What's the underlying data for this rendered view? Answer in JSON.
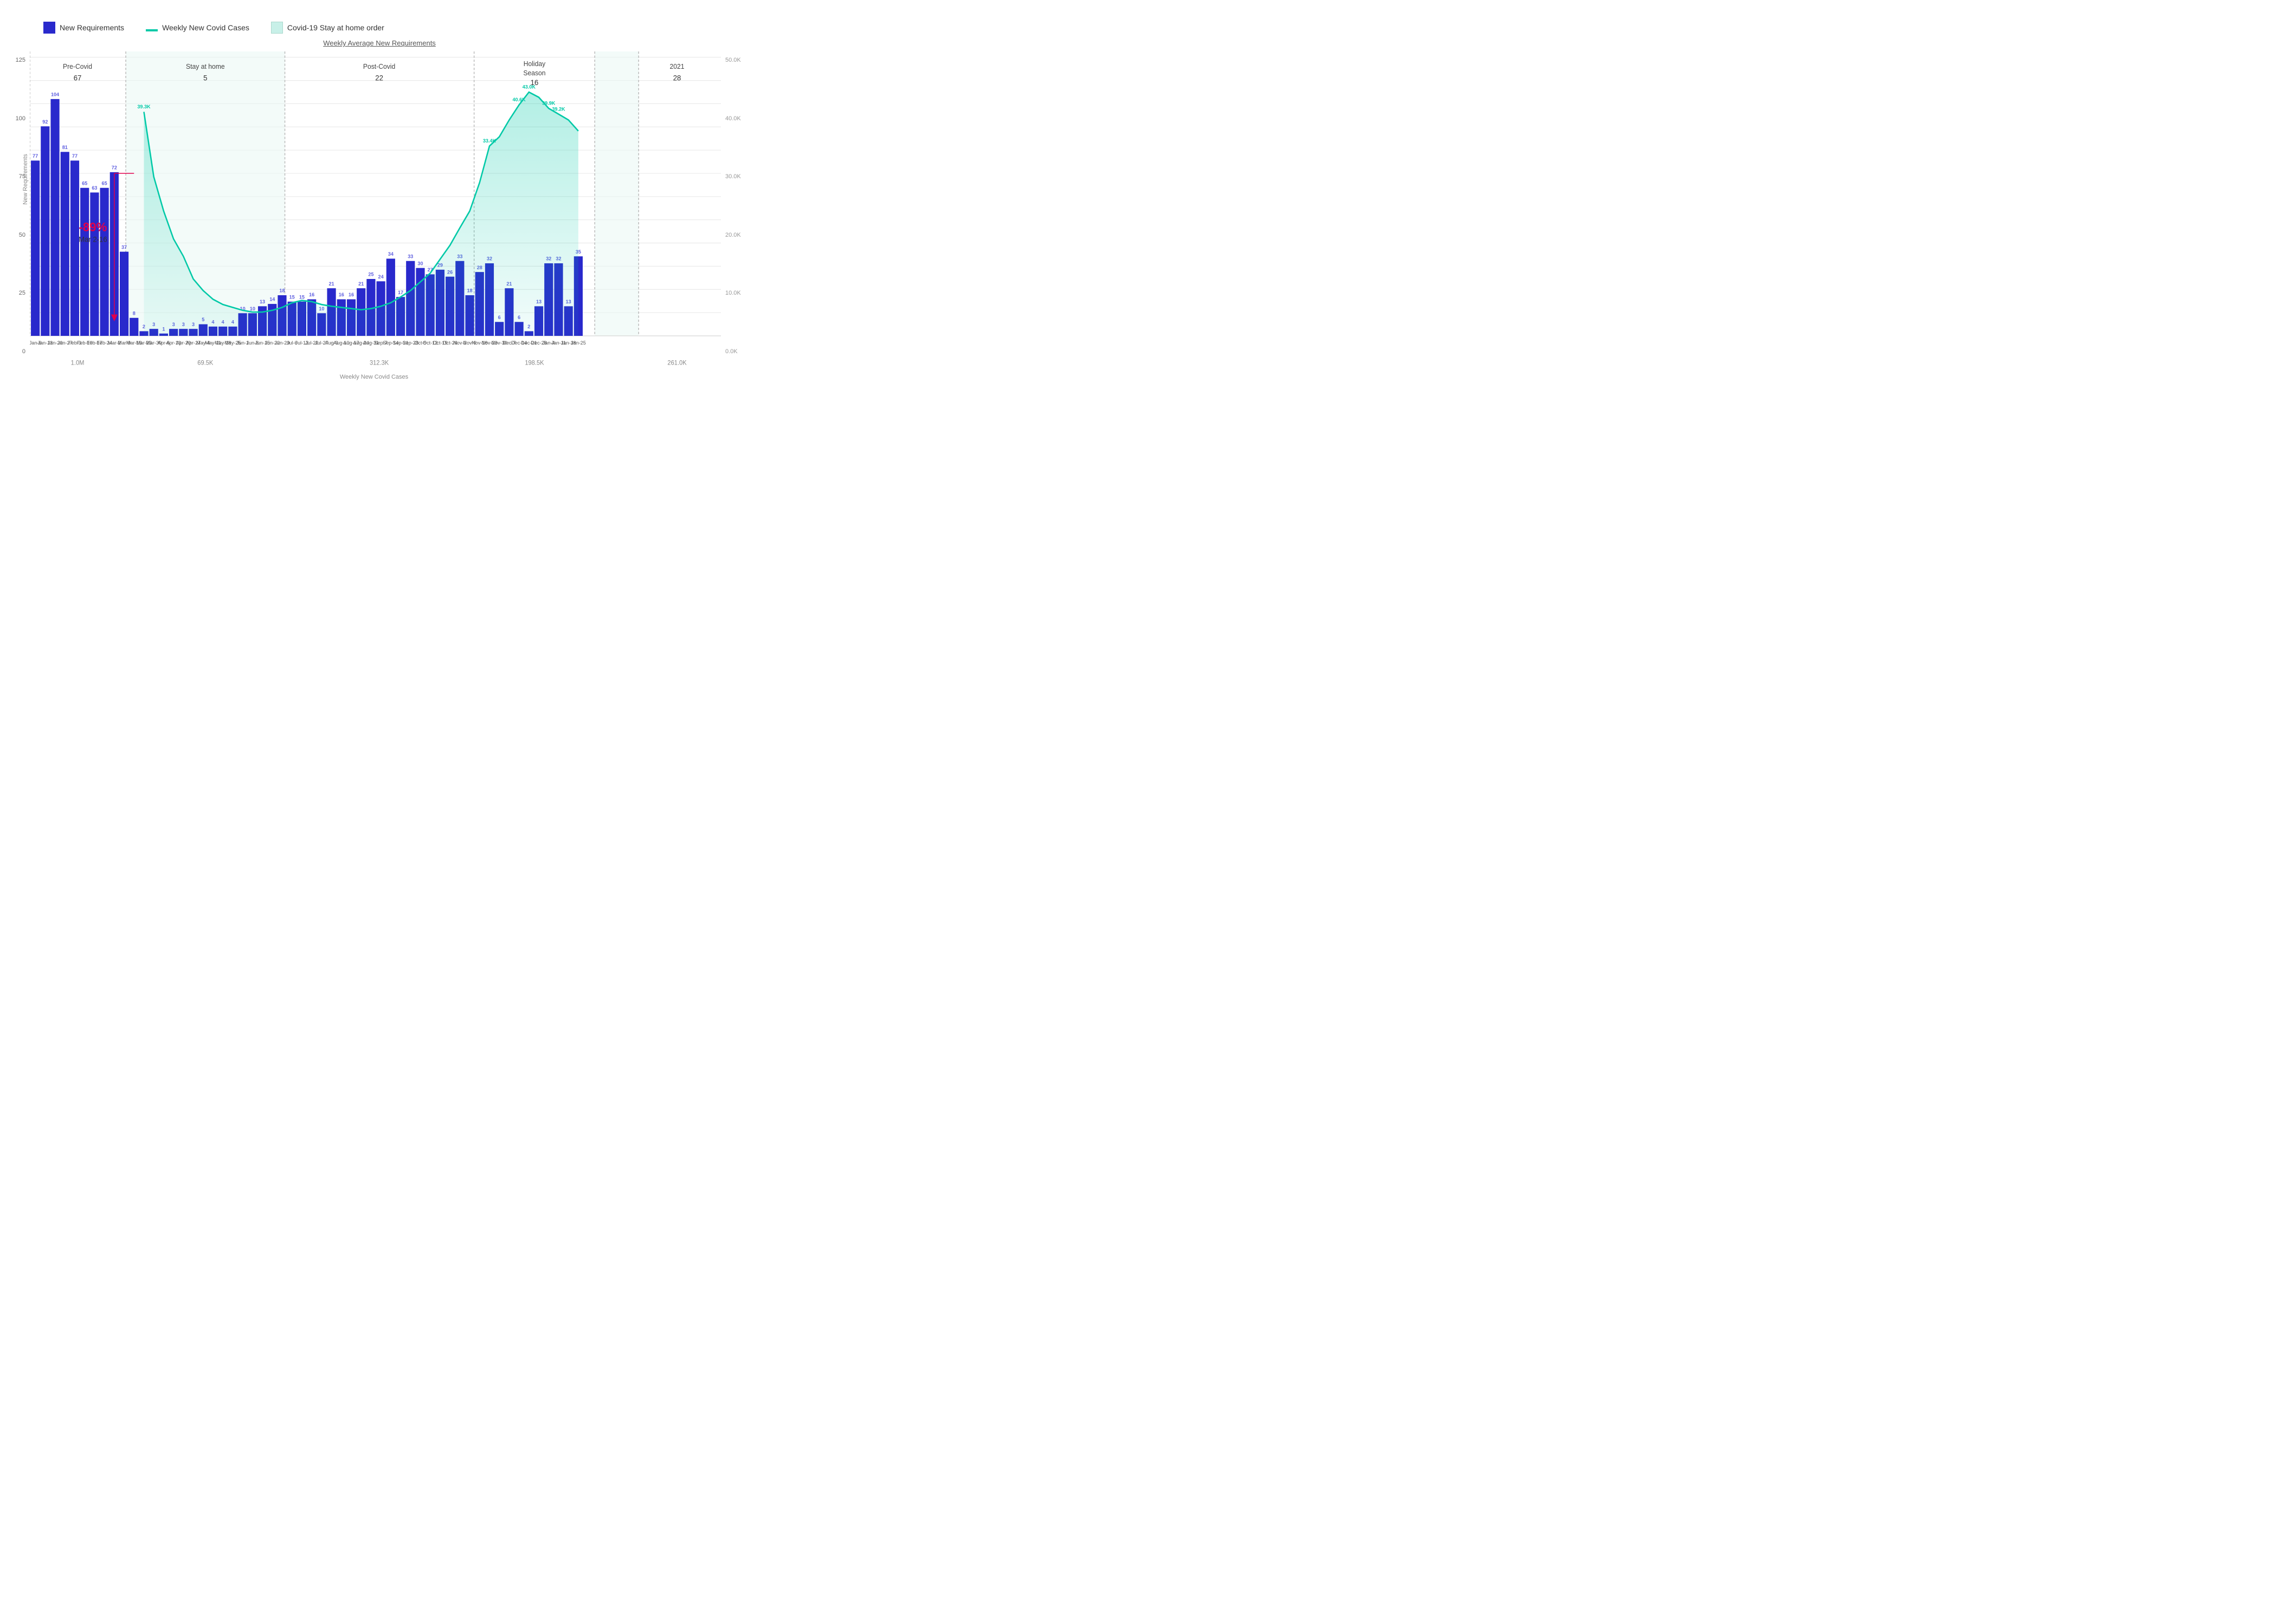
{
  "title": "Weekly Average New Requirements",
  "legend": {
    "items": [
      {
        "label": "New Requirements",
        "color": "#2929cc",
        "type": "box"
      },
      {
        "label": "Weekly New Covid Cases",
        "color": "#00c9a7",
        "type": "line"
      },
      {
        "label": "Covid-19 Stay at home order",
        "color": "#c8f0e8",
        "type": "box"
      }
    ]
  },
  "yAxisLeft": {
    "label": "New Requirements",
    "ticks": [
      "125",
      "100",
      "75",
      "50",
      "25",
      "0"
    ]
  },
  "yAxisRight": {
    "label": "Weekly New Covid Cases",
    "ticks": [
      "50.0K",
      "40.0K",
      "30.0K",
      "20.0K",
      "10.0K",
      "0.0K"
    ]
  },
  "sections": [
    {
      "label": "Pre-Covid",
      "avg": "67"
    },
    {
      "label": "Stay at home",
      "avg": "5"
    },
    {
      "label": "Post-Covid",
      "avg": "22"
    },
    {
      "label": "Holiday\nSeason",
      "avg": "16"
    },
    {
      "label": "2021",
      "avg": "28"
    }
  ],
  "bottomLabels": [
    "1.0M",
    "69.5K",
    "312.3K",
    "198.5K",
    "261.0K"
  ],
  "annotation": {
    "pct": "-89%",
    "date": "Mar 2-16"
  },
  "bars": [
    {
      "x": "Jan-6",
      "v": 77,
      "covidV": null
    },
    {
      "x": "Jan-13",
      "v": 92,
      "covidV": null
    },
    {
      "x": "Jan-20",
      "v": 104,
      "covidV": null
    },
    {
      "x": "Jan-27",
      "v": 81,
      "covidV": null
    },
    {
      "x": "Feb-3",
      "v": 77,
      "covidV": null
    },
    {
      "x": "Feb-10",
      "v": 65,
      "covidV": null
    },
    {
      "x": "Feb-17",
      "v": 63,
      "covidV": null
    },
    {
      "x": "Feb-24",
      "v": 65,
      "covidV": null
    },
    {
      "x": "Mar-2",
      "v": 72,
      "covidV": null
    },
    {
      "x": "Mar-9",
      "v": 37,
      "covidV": null
    },
    {
      "x": "Mar-16",
      "v": 8,
      "covidV": null
    },
    {
      "x": "Mar-23",
      "v": 2,
      "covidV": 39300
    },
    {
      "x": "Mar-30",
      "v": 3,
      "covidV": 28000
    },
    {
      "x": "Apr-6",
      "v": 1,
      "covidV": 22000
    },
    {
      "x": "Apr-13",
      "v": 3,
      "covidV": 17000
    },
    {
      "x": "Apr-20",
      "v": 3,
      "covidV": 13000
    },
    {
      "x": "Apr-27",
      "v": 3,
      "covidV": 10000
    },
    {
      "x": "May-4",
      "v": 5,
      "covidV": 8000
    },
    {
      "x": "May-11",
      "v": 4,
      "covidV": 6500
    },
    {
      "x": "May-18",
      "v": 4,
      "covidV": 5500
    },
    {
      "x": "May-25",
      "v": 4,
      "covidV": 5000
    },
    {
      "x": "Jun-1",
      "v": 10,
      "covidV": 4500
    },
    {
      "x": "Jun-8",
      "v": 10,
      "covidV": 4200
    },
    {
      "x": "Jun-15",
      "v": 13,
      "covidV": 4200
    },
    {
      "x": "Jun-22",
      "v": 14,
      "covidV": 4500
    },
    {
      "x": "Jun-29",
      "v": 18,
      "covidV": 5000
    },
    {
      "x": "Jul-6",
      "v": 15,
      "covidV": 5800
    },
    {
      "x": "Jul-13",
      "v": 15,
      "covidV": 6200
    },
    {
      "x": "Jul-20",
      "v": 16,
      "covidV": 6000
    },
    {
      "x": "Jul-27",
      "v": 10,
      "covidV": 5500
    },
    {
      "x": "Aug-3",
      "v": 21,
      "covidV": 5200
    },
    {
      "x": "Aug-10",
      "v": 16,
      "covidV": 5000
    },
    {
      "x": "Aug-17",
      "v": 16,
      "covidV": 4800
    },
    {
      "x": "Aug-24",
      "v": 21,
      "covidV": 4600
    },
    {
      "x": "Aug-31",
      "v": 25,
      "covidV": 4800
    },
    {
      "x": "Sep-7",
      "v": 24,
      "covidV": 5200
    },
    {
      "x": "Sep-14",
      "v": 34,
      "covidV": 5800
    },
    {
      "x": "Sep-21",
      "v": 17,
      "covidV": 6800
    },
    {
      "x": "Sep-28",
      "v": 33,
      "covidV": 8000
    },
    {
      "x": "Oct-5",
      "v": 30,
      "covidV": 9500
    },
    {
      "x": "Oct-12",
      "v": 27,
      "covidV": 11000
    },
    {
      "x": "Oct-19",
      "v": 29,
      "covidV": 13500
    },
    {
      "x": "Oct-26",
      "v": 26,
      "covidV": 16000
    },
    {
      "x": "Nov-2",
      "v": 33,
      "covidV": 19000
    },
    {
      "x": "Nov-9",
      "v": 18,
      "covidV": 22000
    },
    {
      "x": "Nov-16",
      "v": 28,
      "covidV": 27000
    },
    {
      "x": "Nov-23",
      "v": 32,
      "covidV": 33400
    },
    {
      "x": "Nov-30",
      "v": 6,
      "covidV": 35000
    },
    {
      "x": "Dec-7",
      "v": 21,
      "covidV": 38000
    },
    {
      "x": "Dec-14",
      "v": 6,
      "covidV": 40600
    },
    {
      "x": "Dec-21",
      "v": 2,
      "covidV": 43000
    },
    {
      "x": "Dec-28",
      "v": 13,
      "covidV": 42000
    },
    {
      "x": "Jan-4",
      "v": 32,
      "covidV": 39900
    },
    {
      "x": "Jan-11",
      "v": 32,
      "covidV": 39200
    },
    {
      "x": "Jan-18",
      "v": 13,
      "covidV": 38000
    },
    {
      "x": "Jan-25",
      "v": 35,
      "covidV": 36000
    }
  ]
}
